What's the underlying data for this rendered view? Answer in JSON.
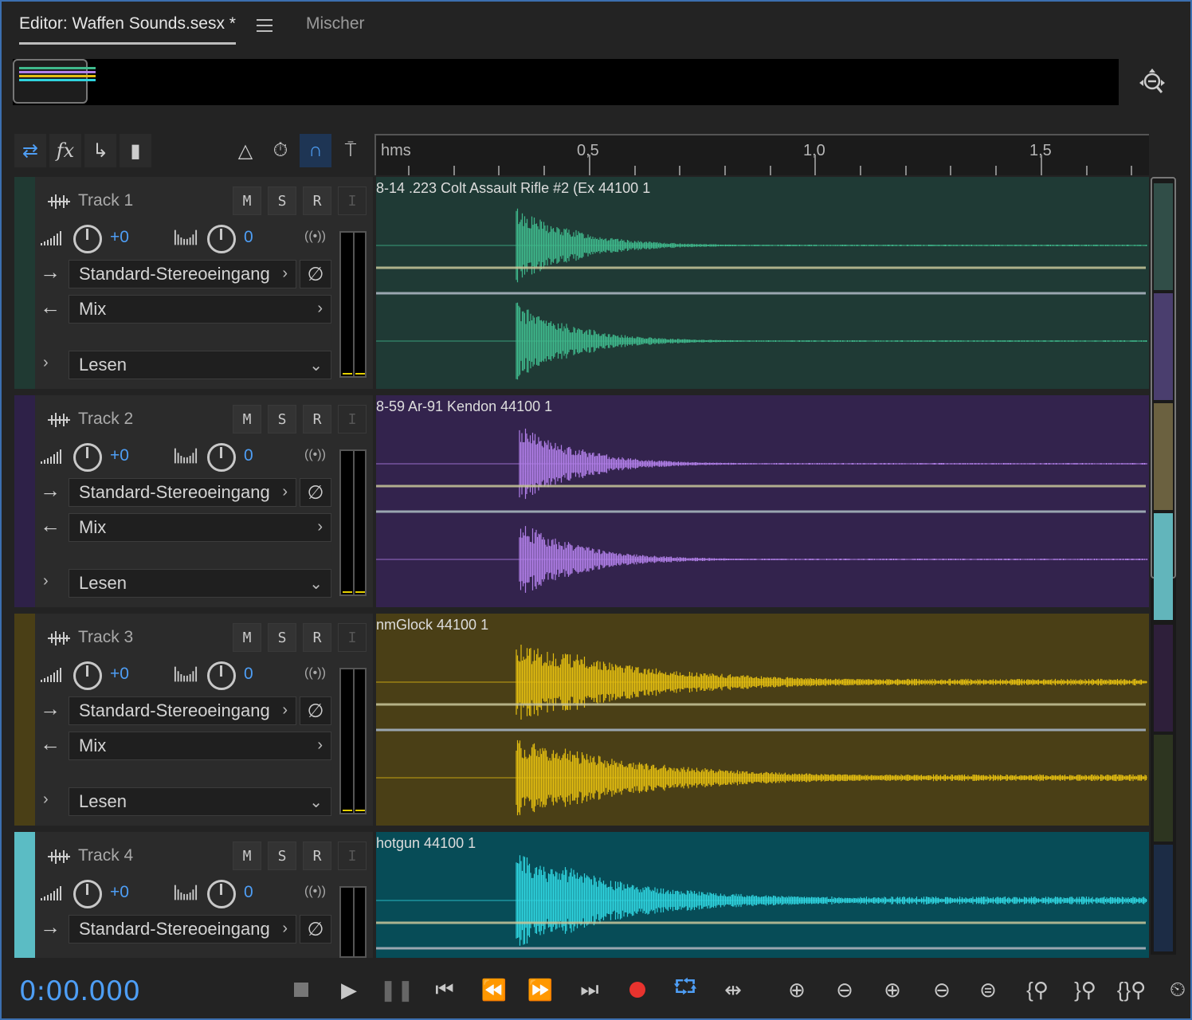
{
  "tabs": {
    "editor_label": "Editor: Waffen Sounds.sesx *",
    "mixer_label": "Mischer"
  },
  "ruler": {
    "unit": "hms",
    "labels": [
      "0,5",
      "1,0",
      "1,5"
    ]
  },
  "track_labels": {
    "mute": "M",
    "solo": "S",
    "record": "R",
    "input": "I",
    "volume": "+0",
    "pan": "0",
    "input_route": "Standard-Stereoeingang",
    "output_route": "Mix",
    "automation": "Lesen"
  },
  "tracks": [
    {
      "name": "Track 1",
      "clip": "8-14 .223 Colt Assault Rifle #2 (Ex 44100 1",
      "color": "#1f3a35",
      "strip": "#203a33",
      "wave": "#3fb98c"
    },
    {
      "name": "Track 2",
      "clip": "8-59 Ar-91 Kendon 44100 1",
      "color": "#33234d",
      "strip": "#2e2148",
      "wave": "#b17fe8"
    },
    {
      "name": "Track 3",
      "clip": "nmGlock 44100 1",
      "color": "#4a3f16",
      "strip": "#4a3f16",
      "wave": "#e3bd10"
    },
    {
      "name": "Track 4",
      "clip": "hotgun 44100 1",
      "color": "#074c57",
      "strip": "#5bbcc4",
      "wave": "#2fd4df"
    }
  ],
  "transport": {
    "timecode": "0:00.000",
    "record_color": "#e8332e",
    "accent_color": "#4e9ef5"
  },
  "icons": [
    "stop-icon",
    "play-icon",
    "pause-icon",
    "go-to-start-icon",
    "rewind-icon",
    "fast-forward-icon",
    "go-to-end-icon",
    "record-icon",
    "loop-icon",
    "skip-icon",
    "zoom-in-amplitude-icon",
    "zoom-out-amplitude-icon",
    "zoom-in-time-icon",
    "zoom-out-time-icon",
    "zoom-full-icon",
    "zoom-in-left-icon",
    "zoom-in-right-icon",
    "zoom-selection-icon",
    "timer-icon"
  ]
}
